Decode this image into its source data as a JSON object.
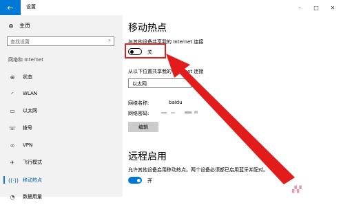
{
  "window": {
    "title": "设置",
    "back_glyph": "←",
    "controls": {
      "minimize": "–",
      "maximize": "□",
      "close": "✕"
    }
  },
  "sidebar": {
    "home_label": "主页",
    "search_placeholder": "查找设置",
    "section_label": "网络和 Internet",
    "items": [
      {
        "label": "状态",
        "icon": "globe-icon"
      },
      {
        "label": "WLAN",
        "icon": "wifi-icon"
      },
      {
        "label": "以太网",
        "icon": "monitor-icon"
      },
      {
        "label": "拨号",
        "icon": "phone-icon"
      },
      {
        "label": "VPN",
        "icon": "vpn-icon"
      },
      {
        "label": "飞行模式",
        "icon": "airplane-icon"
      },
      {
        "label": "移动热点",
        "icon": "hotspot-icon",
        "active": true
      },
      {
        "label": "数据用量",
        "icon": "data-usage-icon"
      }
    ]
  },
  "main": {
    "hotspot_title": "移动热点",
    "share_label": "与其他设备共享我的 Internet 连接",
    "share_toggle_text": "关",
    "share_from_label": "从以下位置共享我的 Internet 连接",
    "share_from_value": "以太网",
    "network_name_label": "网络名称:",
    "network_name_value": "baidu",
    "network_password_label": "网络密码:",
    "edit_button": "编辑",
    "remote_title": "远程启用",
    "remote_desc": "允许其他设备启用移动热点。两个设备必须都已启用蓝牙并配对。",
    "remote_toggle_text": "开"
  },
  "colors": {
    "accent": "#0078d7",
    "annotation_red": "#e21b1b",
    "sidebar_bg": "#f2f2f2"
  }
}
